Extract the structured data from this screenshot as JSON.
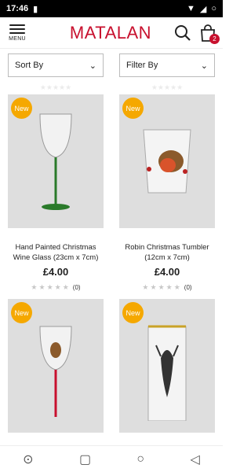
{
  "status": {
    "time": "17:46"
  },
  "header": {
    "menu_label": "MENU",
    "logo": "MATALAN",
    "bag_count": "2"
  },
  "filters": {
    "sort_label": "Sort By",
    "filter_label": "Filter By"
  },
  "products": [
    {
      "badge": "New",
      "title": "Hand Painted Christmas Wine Glass (23cm x 7cm)",
      "price": "£4.00",
      "review_count": "(0)",
      "rating": 0
    },
    {
      "badge": "New",
      "title": "Robin Christmas Tumbler (12cm x 7cm)",
      "price": "£4.00",
      "review_count": "(0)",
      "rating": 0
    },
    {
      "badge": "New",
      "title": "",
      "price": "",
      "review_count": "",
      "rating": 0
    },
    {
      "badge": "New",
      "title": "",
      "price": "",
      "review_count": "",
      "rating": 0
    }
  ],
  "colors": {
    "brand": "#c8102e",
    "badge": "#f5a800",
    "card_bg": "#dedede"
  }
}
